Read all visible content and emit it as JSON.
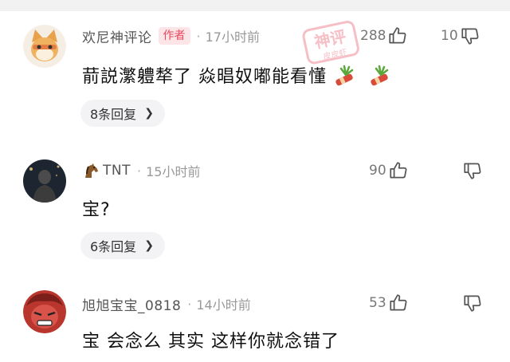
{
  "comments": [
    {
      "username": "欢尼神评论",
      "badge": "作者",
      "time": "17小时前",
      "likes": "288",
      "dislikes": "10",
      "text": "葥説瀿軆㹈了 焱晿奴嘟能看懂",
      "replies": "8条回复"
    },
    {
      "username": "TNT",
      "time": "15小时前",
      "likes": "90",
      "dislikes": "",
      "text": "宝?",
      "replies": "6条回复"
    },
    {
      "username": "旭旭宝宝_0818",
      "time": "14小时前",
      "likes": "53",
      "dislikes": "",
      "text": "宝 会念么 其实 这样你就念错了"
    }
  ],
  "separator": "·",
  "watermark": {
    "line1": "神评",
    "line2": "皮皮虾"
  },
  "colors": {
    "badge_text": "#e84a5f",
    "badge_bg": "#fde4e6",
    "meta_gray": "#999999",
    "pill_bg": "#f3f3f5"
  }
}
